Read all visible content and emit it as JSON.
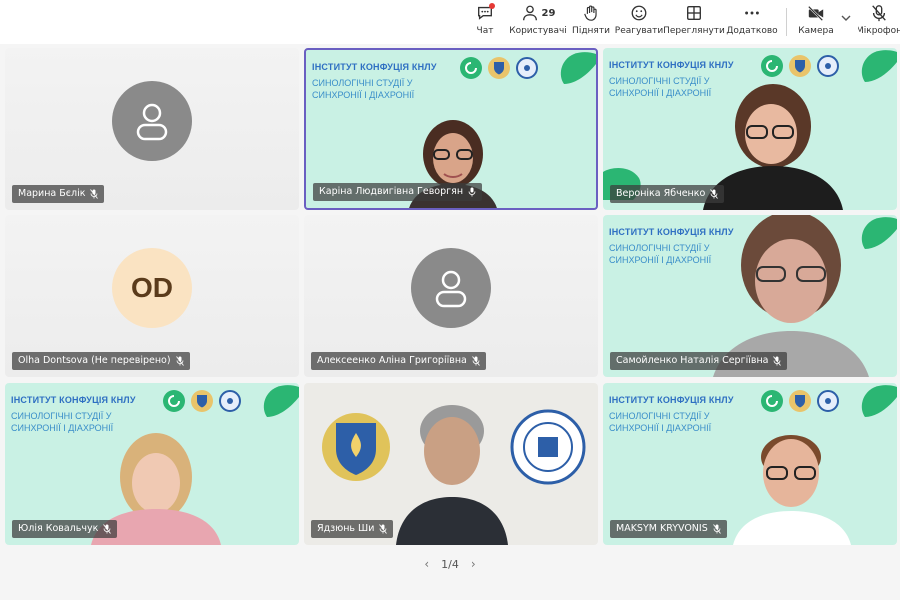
{
  "toolbar": {
    "items": [
      {
        "label": "Чат",
        "icon": "chat-icon"
      },
      {
        "label": "Користувачі",
        "icon": "people-icon",
        "count": "29"
      },
      {
        "label": "Підняти",
        "icon": "raise-hand-icon"
      },
      {
        "label": "Реагувати",
        "icon": "emoji-icon"
      },
      {
        "label": "Переглянути",
        "icon": "grid-view-icon"
      },
      {
        "label": "Додатково",
        "icon": "more-icon"
      },
      {
        "label": "Камера",
        "icon": "camera-off-icon"
      },
      {
        "label": "Мікрофон",
        "icon": "mic-off-icon"
      }
    ]
  },
  "branding": {
    "title": "ІНСТИТУТ КОНФУЦІЯ КНЛУ",
    "subtitle": "СИНОЛОГІЧНІ СТУДІЇ У СИНХРОНІЇ І ДІАХРОНІЇ"
  },
  "participants": [
    {
      "name": "Марина Бєлік",
      "type": "avatar"
    },
    {
      "name": "Каріна Людвигівна Геворгян",
      "type": "video",
      "active": true
    },
    {
      "name": "Вероніка Ябченко",
      "type": "video"
    },
    {
      "name": "Olha Dontsova (Не перевірено)",
      "type": "initials",
      "initials": "OD"
    },
    {
      "name": "Алексеенко Аліна Григоріївна",
      "type": "avatar"
    },
    {
      "name": "Самойленко Наталія Сергіївна",
      "type": "video"
    },
    {
      "name": "Юлія Ковальчук",
      "type": "video"
    },
    {
      "name": "Ядзюнь Ши",
      "type": "video"
    },
    {
      "name": "MAKSYM KRYVONIS",
      "type": "video"
    }
  ],
  "pager": {
    "label": "1/4"
  },
  "colors": {
    "accent": "#6a5fc1",
    "mint": "#c9f1e4",
    "brand_blue": "#2e6fc2",
    "brand_green": "#2bb673"
  }
}
